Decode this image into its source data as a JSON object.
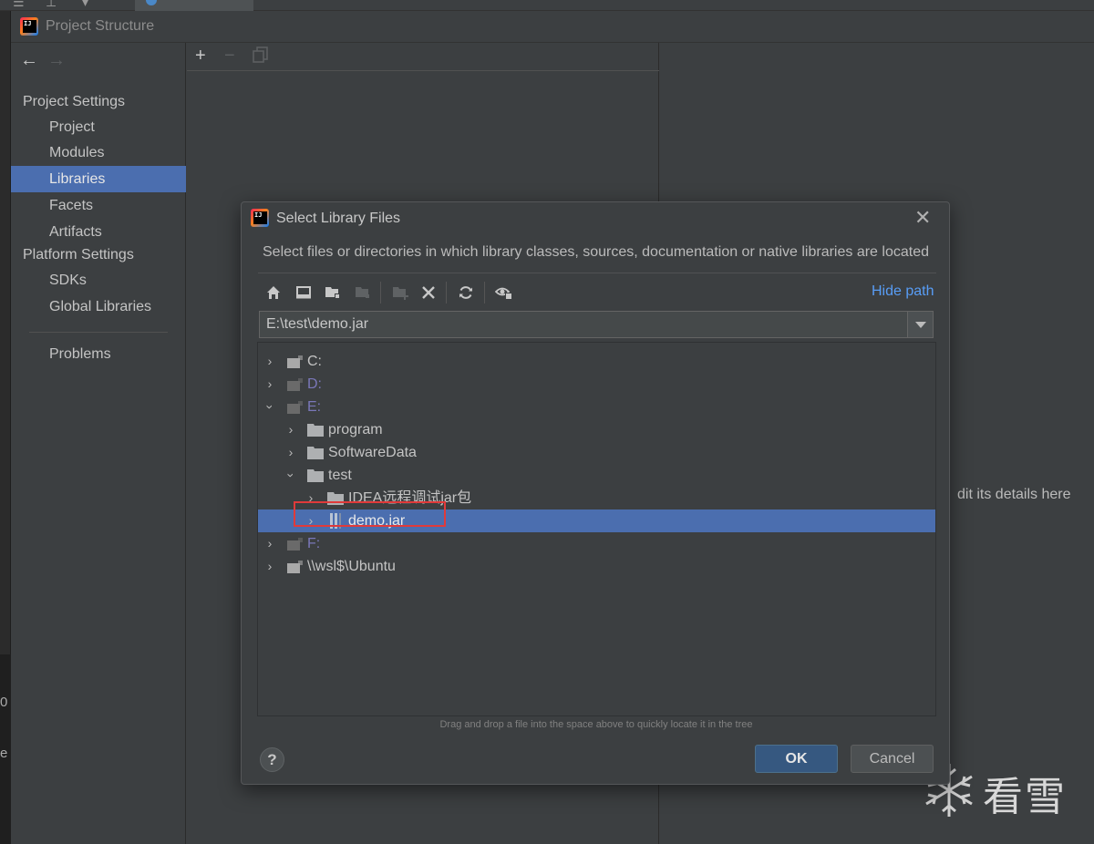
{
  "window": {
    "title": "Project Structure"
  },
  "sidebar": {
    "sections": [
      {
        "label": "Project Settings"
      },
      {
        "label": "Platform Settings"
      }
    ],
    "items": [
      {
        "label": "Project"
      },
      {
        "label": "Modules"
      },
      {
        "label": "Libraries",
        "selected": true
      },
      {
        "label": "Facets"
      },
      {
        "label": "Artifacts"
      },
      {
        "label": "SDKs"
      },
      {
        "label": "Global Libraries"
      },
      {
        "label": "Problems"
      }
    ]
  },
  "middle_toolbar": {
    "icons": [
      "add-icon",
      "remove-icon",
      "copy-icon"
    ]
  },
  "right_panel": {
    "hint_text": "dit its details here"
  },
  "dialog": {
    "title": "Select Library Files",
    "description": "Select files or directories in which library classes, sources, documentation or native libraries are located",
    "hide_path_label": "Hide path",
    "path_value": "E:\\test\\demo.jar",
    "toolbar_icons": [
      "home-icon",
      "desktop-icon",
      "project-folder-icon",
      "module-folder-icon",
      "new-folder-icon",
      "delete-icon",
      "refresh-icon",
      "show-hidden-icon"
    ],
    "tree": [
      {
        "label": "C:",
        "expanded": false
      },
      {
        "label": "D:",
        "expanded": false
      },
      {
        "label": "E:",
        "expanded": true
      },
      {
        "label": "program",
        "expanded": false
      },
      {
        "label": "SoftwareData",
        "expanded": false
      },
      {
        "label": "test",
        "expanded": true
      },
      {
        "label": "IDEA远程调试jar包",
        "expanded": false
      },
      {
        "label": "demo.jar",
        "expanded": false,
        "selected": true
      },
      {
        "label": "F:",
        "expanded": false
      },
      {
        "label": "\\\\wsl$\\Ubuntu",
        "expanded": false
      }
    ],
    "drag_note": "Drag and drop a file into the space above to quickly locate it in the tree",
    "help_label": "?",
    "ok_label": "OK",
    "cancel_label": "Cancel"
  },
  "watermark": {
    "text": "看雪"
  },
  "colors": {
    "selection": "#4b6eaf",
    "link": "#589df6",
    "primary_button": "#365880",
    "highlight_box": "#e03a3a"
  }
}
